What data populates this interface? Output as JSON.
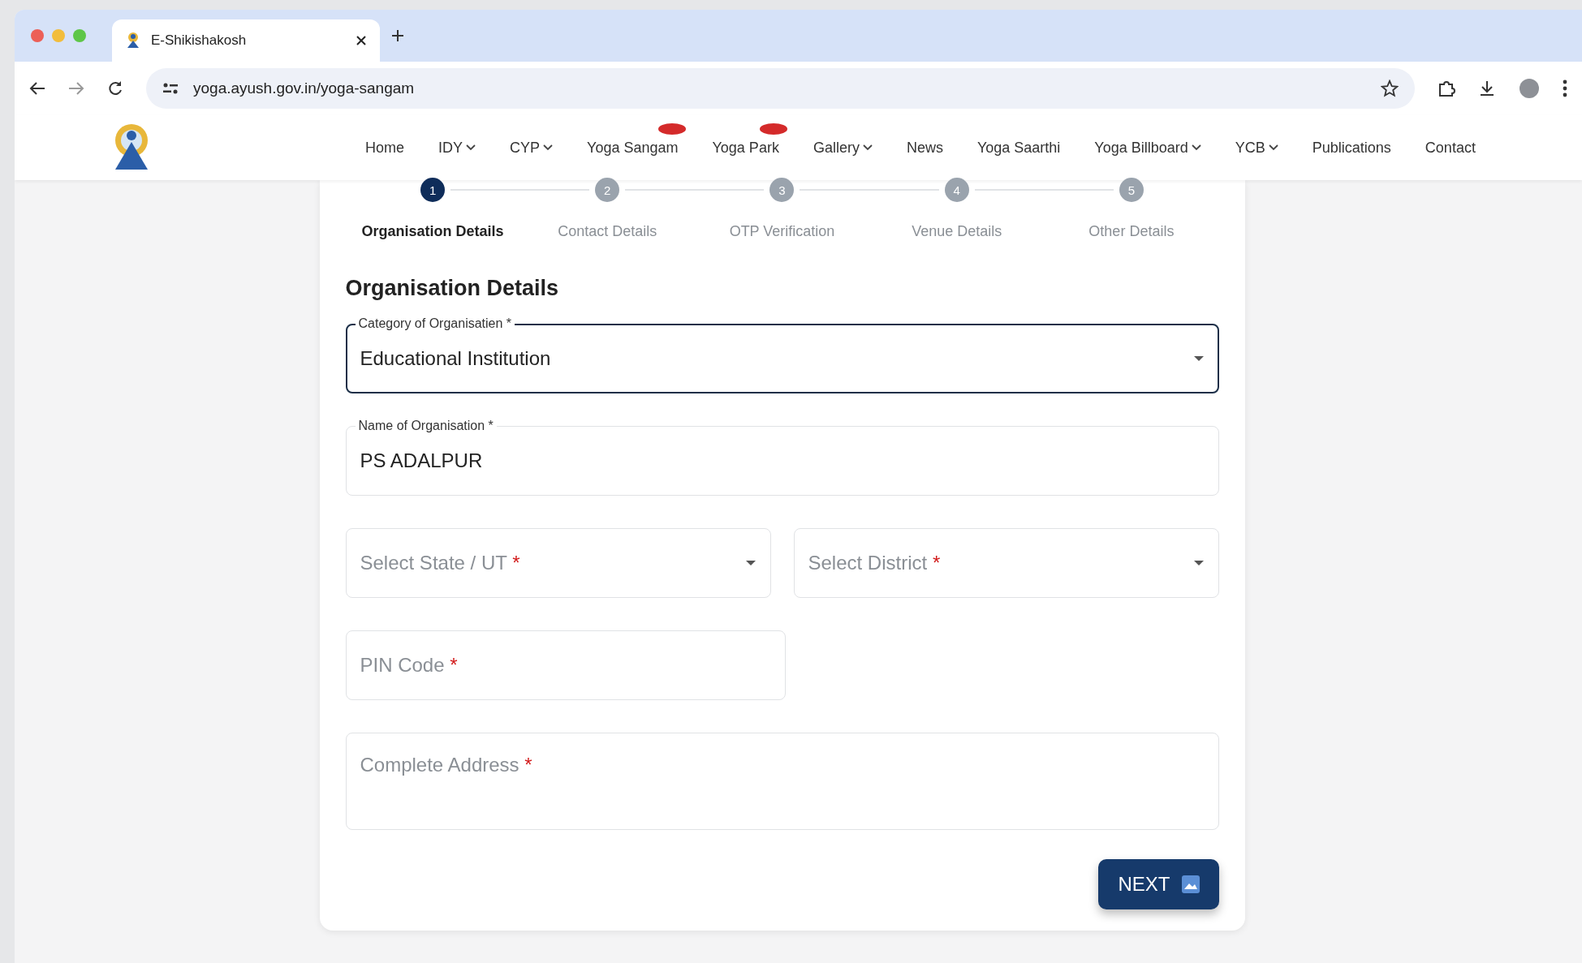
{
  "browser": {
    "tab_title": "E-Shikishakosh",
    "url": "yoga.ayush.gov.in/yoga-sangam"
  },
  "nav": [
    {
      "label": "Home",
      "dropdown": false,
      "badge": false
    },
    {
      "label": "IDY",
      "dropdown": true,
      "badge": false
    },
    {
      "label": "CYP",
      "dropdown": true,
      "badge": false
    },
    {
      "label": "Yoga Sangam",
      "dropdown": false,
      "badge": true
    },
    {
      "label": "Yoga Park",
      "dropdown": false,
      "badge": true
    },
    {
      "label": "Gallery",
      "dropdown": true,
      "badge": false
    },
    {
      "label": "News",
      "dropdown": false,
      "badge": false
    },
    {
      "label": "Yoga Saarthi",
      "dropdown": false,
      "badge": false
    },
    {
      "label": "Yoga Billboard",
      "dropdown": true,
      "badge": false
    },
    {
      "label": "YCB",
      "dropdown": true,
      "badge": false
    },
    {
      "label": "Publications",
      "dropdown": false,
      "badge": false
    },
    {
      "label": "Contact",
      "dropdown": false,
      "badge": false
    }
  ],
  "steps": [
    {
      "number": "1",
      "label": "Organisation Details",
      "selected": true
    },
    {
      "number": "2",
      "label": "Contact Details",
      "selected": false
    },
    {
      "number": "3",
      "label": "OTP Verification",
      "selected": false
    },
    {
      "number": "4",
      "label": "Venue Details",
      "selected": false
    },
    {
      "number": "5",
      "label": "Other Details",
      "selected": false
    }
  ],
  "form": {
    "heading": "Organisation Details",
    "rows": [
      [
        {
          "kind": "select",
          "label": "Category of Organisatien",
          "required_mark": "*",
          "value": "Educational Institution",
          "focused": true
        }
      ],
      [
        {
          "kind": "text",
          "label": "Name of Organisation",
          "required_mark": "*",
          "value": "PS ADALPUR",
          "focused": false
        }
      ],
      [
        {
          "kind": "select",
          "placeholder": "Select State / UT",
          "required_mark": "*",
          "focused": false
        },
        {
          "kind": "select",
          "placeholder": "Select District",
          "required_mark": "*",
          "focused": false
        }
      ],
      [
        {
          "kind": "text",
          "placeholder": "PIN Code",
          "required_mark": "*",
          "focused": false
        },
        {
          "kind": "empty"
        }
      ],
      [
        {
          "kind": "textarea",
          "placeholder": "Complete Address",
          "required_mark": "*",
          "focused": false
        }
      ]
    ],
    "next_button": "NEXT"
  }
}
